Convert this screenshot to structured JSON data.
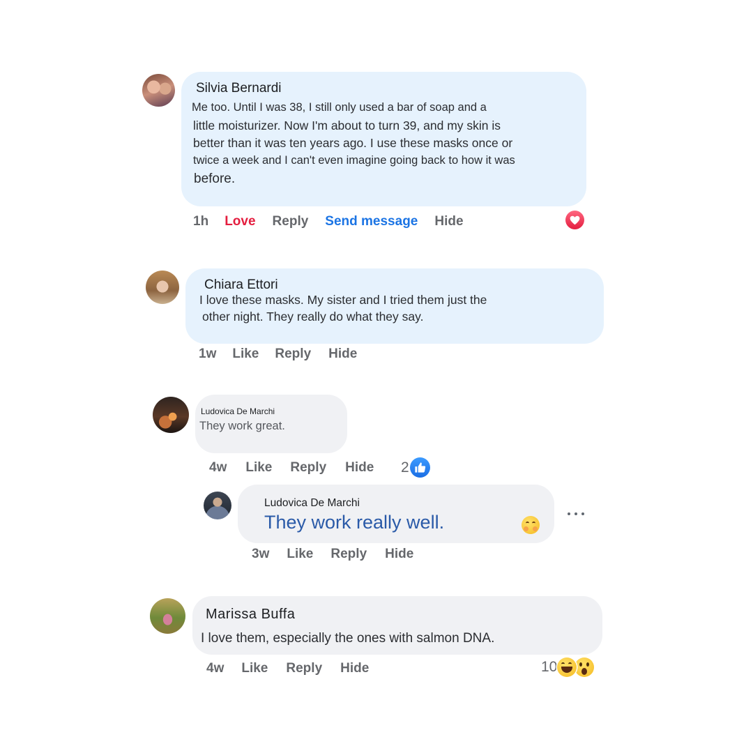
{
  "comments": [
    {
      "author": "Silvia Bernardi",
      "lines": [
        "Me too. Until I was 38, I still only used a bar of soap and a",
        "little moisturizer. Now I'm about to turn 39, and my skin is",
        "better than it was ten years ago. I use these masks once or",
        "twice a week and I can't even imagine going back to how it was",
        "before."
      ],
      "time": "1h",
      "reaction_label": "Love",
      "reply": "Reply",
      "send_message": "Send message",
      "hide": "Hide",
      "reaction_icon": "heart-icon"
    },
    {
      "author": "Chiara Ettori",
      "lines": [
        "I love these masks. My sister and I tried them just the",
        "other night. They really do what they say."
      ],
      "time": "1w",
      "like": "Like",
      "reply": "Reply",
      "hide": "Hide"
    },
    {
      "author": "Ludovica De Marchi",
      "lines": [
        "They work great."
      ],
      "time": "4w",
      "like": "Like",
      "reply": "Reply",
      "hide": "Hide",
      "reaction_count": "2",
      "reaction_icon": "thumbs-up-icon"
    },
    {
      "author": "Ludovica De Marchi",
      "lines": [
        "They work really well."
      ],
      "sticker_icon": "hug-emoji-icon",
      "more_icon": "more-options-icon",
      "time": "3w",
      "like": "Like",
      "reply": "Reply",
      "hide": "Hide"
    },
    {
      "author": "Marissa Buffa",
      "lines": [
        "I love them, especially the ones with salmon DNA."
      ],
      "time": "4w",
      "like": "Like",
      "reply": "Reply",
      "hide": "Hide",
      "reaction_count": "10",
      "reaction_icons": [
        "laughing-emoji-icon",
        "wow-emoji-icon"
      ]
    }
  ],
  "colors": {
    "love": "#e41e3f",
    "link_blue": "#1b74e4",
    "action_grey": "#65676b",
    "bubble_blue": "#e6f2fd",
    "bubble_grey": "#f0f1f4",
    "reply_text_blue": "#2a5aa8"
  }
}
